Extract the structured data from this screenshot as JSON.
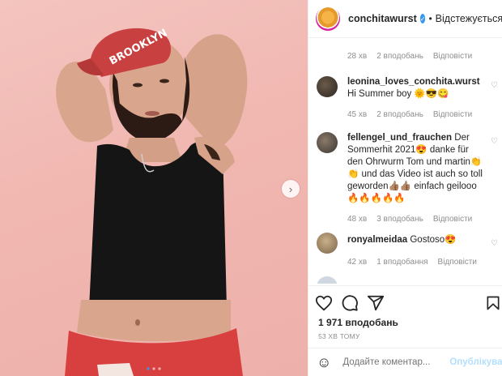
{
  "header": {
    "username": "conchitawurst",
    "follow_label": "Відстежується"
  },
  "photo": {
    "cap_text": "BROOKLYN"
  },
  "comments": [
    {
      "username": "",
      "text": "",
      "time": "28 хв",
      "likes": "2 вподобань",
      "reply": "Відповісти"
    },
    {
      "username": "leonina_loves_conchita.wurst",
      "text": "Hi Summer boy 🌞😎😋",
      "time": "45 хв",
      "likes": "2 вподобань",
      "reply": "Відповісти"
    },
    {
      "username": "fellengel_und_frauchen",
      "text": "Der Sommerhit 2021😍 danke für den Ohrwurm Tom und martin👏👏 und das Video ist auch so toll geworden👍🏽👍🏽 einfach geilooo🔥🔥🔥🔥🔥",
      "time": "48 хв",
      "likes": "3 вподобань",
      "reply": "Відповісти"
    },
    {
      "username": "ronyalmeidaa",
      "text": "Gostoso😍",
      "time": "42 хв",
      "likes": "1 вподобання",
      "reply": "Відповісти"
    }
  ],
  "actions": {
    "likes_count": "1 971 вподобань",
    "time_ago": "53 ХВ ТОМУ"
  },
  "add_comment": {
    "placeholder": "Додайте коментар...",
    "post_label": "Опублікувати"
  },
  "colors": {
    "verified": "#3897f0",
    "meta_grey": "#8e8e8e",
    "post_disabled": "#b2dffc",
    "background_pink": "#f1b7b1"
  }
}
